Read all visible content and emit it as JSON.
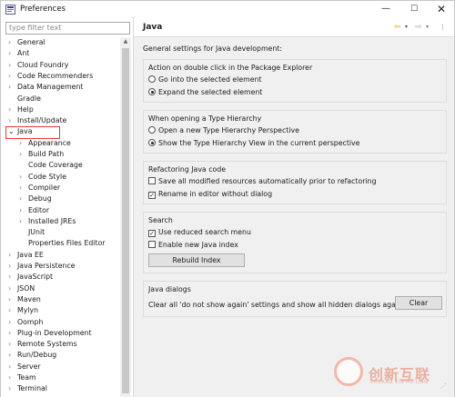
{
  "window": {
    "title": "Preferences",
    "minimize": "—",
    "maximize": "☐",
    "close": "✕"
  },
  "sidebar": {
    "filter_placeholder": "type filter text",
    "items": [
      {
        "label": "General",
        "arrow": "›",
        "level": 0
      },
      {
        "label": "Ant",
        "arrow": "›",
        "level": 0
      },
      {
        "label": "Cloud Foundry",
        "arrow": "›",
        "level": 0
      },
      {
        "label": "Code Recommenders",
        "arrow": "›",
        "level": 0
      },
      {
        "label": "Data Management",
        "arrow": "›",
        "level": 0
      },
      {
        "label": "Gradle",
        "arrow": "",
        "level": 0
      },
      {
        "label": "Help",
        "arrow": "›",
        "level": 0
      },
      {
        "label": "Install/Update",
        "arrow": "›",
        "level": 0
      },
      {
        "label": "Java",
        "arrow": "⌄",
        "level": 0
      },
      {
        "label": "Appearance",
        "arrow": "›",
        "level": 1
      },
      {
        "label": "Build Path",
        "arrow": "›",
        "level": 1
      },
      {
        "label": "Code Coverage",
        "arrow": "",
        "level": 1
      },
      {
        "label": "Code Style",
        "arrow": "›",
        "level": 1
      },
      {
        "label": "Compiler",
        "arrow": "›",
        "level": 1
      },
      {
        "label": "Debug",
        "arrow": "›",
        "level": 1
      },
      {
        "label": "Editor",
        "arrow": "›",
        "level": 1
      },
      {
        "label": "Installed JREs",
        "arrow": "›",
        "level": 1
      },
      {
        "label": "JUnit",
        "arrow": "",
        "level": 1
      },
      {
        "label": "Properties Files Editor",
        "arrow": "",
        "level": 1
      },
      {
        "label": "Java EE",
        "arrow": "›",
        "level": 0
      },
      {
        "label": "Java Persistence",
        "arrow": "›",
        "level": 0
      },
      {
        "label": "JavaScript",
        "arrow": "›",
        "level": 0
      },
      {
        "label": "JSON",
        "arrow": "›",
        "level": 0
      },
      {
        "label": "Maven",
        "arrow": "›",
        "level": 0
      },
      {
        "label": "Mylyn",
        "arrow": "›",
        "level": 0
      },
      {
        "label": "Oomph",
        "arrow": "›",
        "level": 0
      },
      {
        "label": "Plug-in Development",
        "arrow": "›",
        "level": 0
      },
      {
        "label": "Remote Systems",
        "arrow": "›",
        "level": 0
      },
      {
        "label": "Run/Debug",
        "arrow": "›",
        "level": 0
      },
      {
        "label": "Server",
        "arrow": "›",
        "level": 0
      },
      {
        "label": "Team",
        "arrow": "›",
        "level": 0
      },
      {
        "label": "Terminal",
        "arrow": "›",
        "level": 0
      }
    ]
  },
  "page": {
    "title": "Java",
    "description": "General settings for Java development:",
    "nav": {
      "back": "⇦",
      "forward": "⇨",
      "dropdown": "▾",
      "menu": "⋮"
    },
    "groups": {
      "double_click": {
        "title": "Action on double click in the Package Explorer",
        "options": [
          "Go into the selected element",
          "Expand the selected element"
        ]
      },
      "type_hierarchy": {
        "title": "When opening a Type Hierarchy",
        "options": [
          "Open a new Type Hierarchy Perspective",
          "Show the Type Hierarchy View in the current perspective"
        ]
      },
      "refactoring": {
        "title": "Refactoring Java code",
        "options": [
          "Save all modified resources automatically prior to refactoring",
          "Rename in editor without dialog"
        ]
      },
      "search": {
        "title": "Search",
        "options": [
          "Use reduced search menu",
          "Enable new Java index"
        ],
        "rebuild_label": "Rebuild Index"
      },
      "dialogs": {
        "title": "Java dialogs",
        "text": "Clear all 'do not show again' settings and show all hidden dialogs again",
        "clear_label": "Clear"
      }
    }
  },
  "watermark": {
    "text": "创新互联",
    "sub": "CHUANG XIN HU LIAN"
  },
  "colors": {
    "highlight": "#e53935",
    "back_arrow": "#e0a020"
  }
}
